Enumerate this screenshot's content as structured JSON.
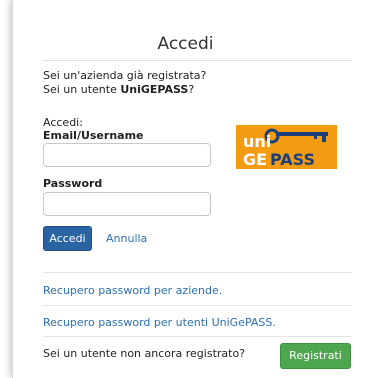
{
  "dialog": {
    "title": "Accedi"
  },
  "intro": {
    "line1": "Sei un'azienda già registrata?",
    "line2_prefix": "Sei un utente ",
    "line2_brand": "UniGEPASS",
    "line2_suffix": "?"
  },
  "form": {
    "section_label": "Accedi:",
    "email_label": "Email/Username",
    "email_value": "",
    "password_label": "Password",
    "password_value": "",
    "submit_label": "Accedi",
    "cancel_label": "Annulla"
  },
  "logo": {
    "brand_text": "uniGEPASS",
    "color": "#f39c11"
  },
  "links": {
    "company_recovery": "Recupero password per aziende.",
    "user_recovery": "Recupero password per utenti UniGePASS."
  },
  "register": {
    "prompt": "Sei un utente non ancora registrato?",
    "button_label": "Registrati"
  }
}
